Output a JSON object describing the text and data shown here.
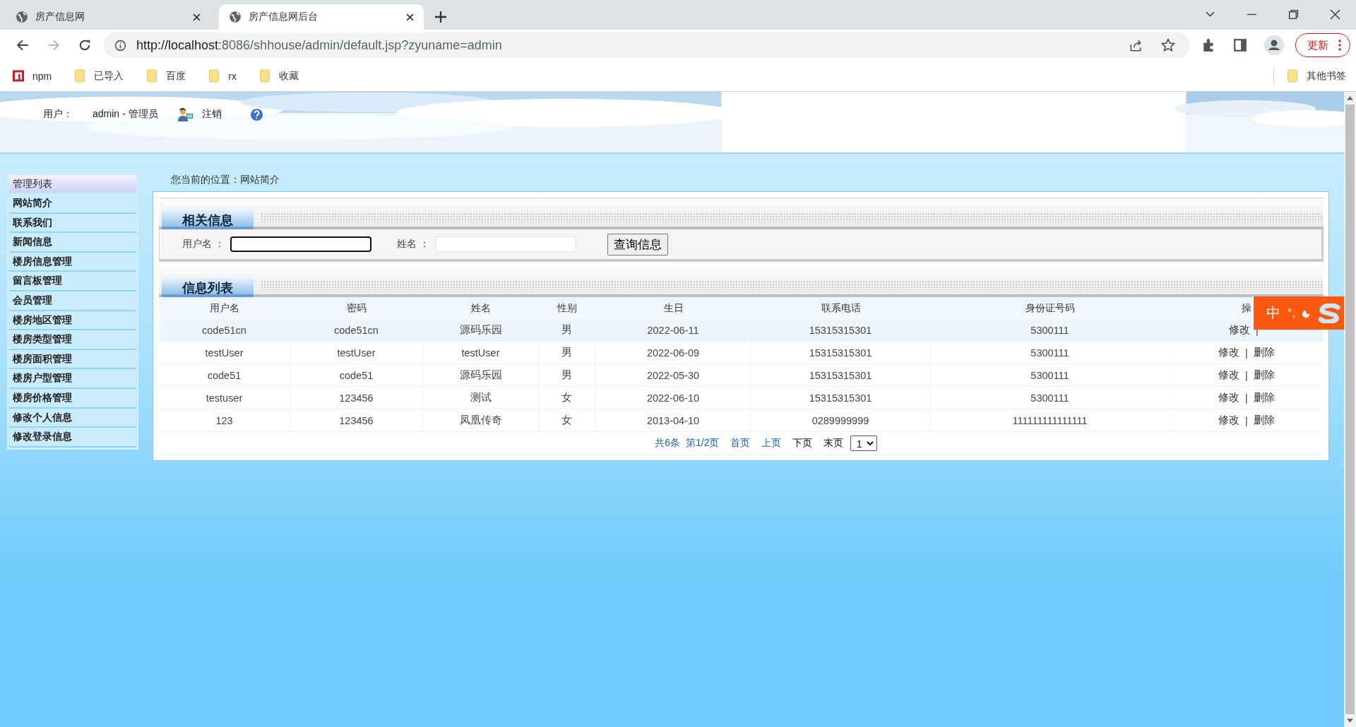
{
  "browser": {
    "tabs": [
      {
        "title": "房产信息网",
        "selected": false
      },
      {
        "title": "房产信息网后台",
        "selected": true
      }
    ],
    "url_host": "http://localhost",
    "url_rest": ":8086/shhouse/admin/default.jsp?zyuname=admin",
    "update_button": "更新",
    "bookmarks": [
      {
        "label": "npm",
        "kind": "npm"
      },
      {
        "label": "已导入",
        "kind": "folder"
      },
      {
        "label": "百度",
        "kind": "folder"
      },
      {
        "label": "rx",
        "kind": "folder"
      },
      {
        "label": "收藏",
        "kind": "folder"
      }
    ],
    "other_bookmarks": "其他书签"
  },
  "header": {
    "user_label": "用户：",
    "user_value": "admin - 管理员",
    "logout": "注销"
  },
  "sidebar": {
    "title": "管理列表",
    "items": [
      "网站简介",
      "联系我们",
      "新闻信息",
      "楼房信息管理",
      "留言板管理",
      "会员管理",
      "楼房地区管理",
      "楼房类型管理",
      "楼房面积管理",
      "楼房户型管理",
      "楼房价格管理",
      "修改个人信息",
      "修改登录信息"
    ]
  },
  "breadcrumb": "您当前的位置：网站简介",
  "search_section": {
    "title": "相关信息",
    "fields": [
      {
        "label": "用户名 ：",
        "focused": true
      },
      {
        "label": "姓名 ：",
        "focused": false
      }
    ],
    "button": "查询信息"
  },
  "list_section": {
    "title": "信息列表",
    "columns": [
      "用户名",
      "密码",
      "姓名",
      "性别",
      "生日",
      "联系电话",
      "身份证号码",
      "操"
    ],
    "rows": [
      {
        "highlighted": true,
        "cells": [
          "code51cn",
          "code51cn",
          "源码乐园",
          "男",
          "2022-06-11",
          "15315315301",
          "5300111"
        ],
        "actions": [
          "修改",
          "|"
        ]
      },
      {
        "highlighted": false,
        "cells": [
          "testUser",
          "testUser",
          "testUser",
          "男",
          "2022-06-09",
          "15315315301",
          "5300111"
        ],
        "actions": [
          "修改",
          "|",
          "删除"
        ]
      },
      {
        "highlighted": false,
        "cells": [
          "code51",
          "code51",
          "源码乐园",
          "男",
          "2022-05-30",
          "15315315301",
          "5300111"
        ],
        "actions": [
          "修改",
          "|",
          "删除"
        ]
      },
      {
        "highlighted": false,
        "cells": [
          "testuser",
          "123456",
          "测试",
          "女",
          "2022-06-10",
          "15315315301",
          "5300111"
        ],
        "actions": [
          "修改",
          "|",
          "删除"
        ]
      },
      {
        "highlighted": false,
        "cells": [
          "123",
          "123456",
          "凤凰传奇",
          "女",
          "2013-04-10",
          "0289999999",
          "111111111111111"
        ],
        "actions": [
          "修改",
          "|",
          "删除"
        ]
      }
    ]
  },
  "pagination": {
    "items": [
      {
        "label": "共6条",
        "link": true
      },
      {
        "label": "第1/2页",
        "link": true
      },
      {
        "label": "首页",
        "link": true
      },
      {
        "label": "上页",
        "link": true
      },
      {
        "label": "下页",
        "link": false
      },
      {
        "label": "末页",
        "link": false
      }
    ],
    "page_select": "1"
  },
  "ime": {
    "mode": "中",
    "punct": "°,"
  }
}
